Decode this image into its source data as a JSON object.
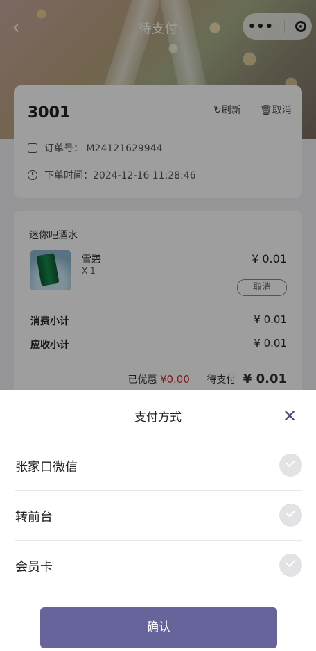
{
  "nav": {
    "title": "待支付",
    "back_icon": "chevron-left-icon",
    "more_icon": "more-dots-icon",
    "close_icon": "target-icon"
  },
  "order": {
    "room": "3001",
    "refresh_label": "刷新",
    "cancel_label": "取消",
    "order_no_label": "订单号：",
    "order_no": "M24121629944",
    "time_label": "下单时间：",
    "time": "2024-12-16 11:28:46"
  },
  "items_section": {
    "title": "迷你吧酒水",
    "items": [
      {
        "name": "雪碧",
        "qty": "X 1",
        "price": "¥ 0.01",
        "cancel_label": "取消"
      }
    ],
    "consume_label": "消费小计",
    "consume_value": "¥ 0.01",
    "receivable_label": "应收小计",
    "receivable_value": "¥ 0.01",
    "discount_label": "已优惠",
    "discount_value": "¥0.00",
    "pending_label": "待支付",
    "pending_value": "¥ 0.01"
  },
  "payment_sheet": {
    "title": "支付方式",
    "options": [
      {
        "label": "张家口微信"
      },
      {
        "label": "转前台"
      },
      {
        "label": "会员卡"
      }
    ],
    "confirm_label": "确认"
  },
  "colors": {
    "accent": "#67639b",
    "discount_red": "#d62a2a"
  }
}
